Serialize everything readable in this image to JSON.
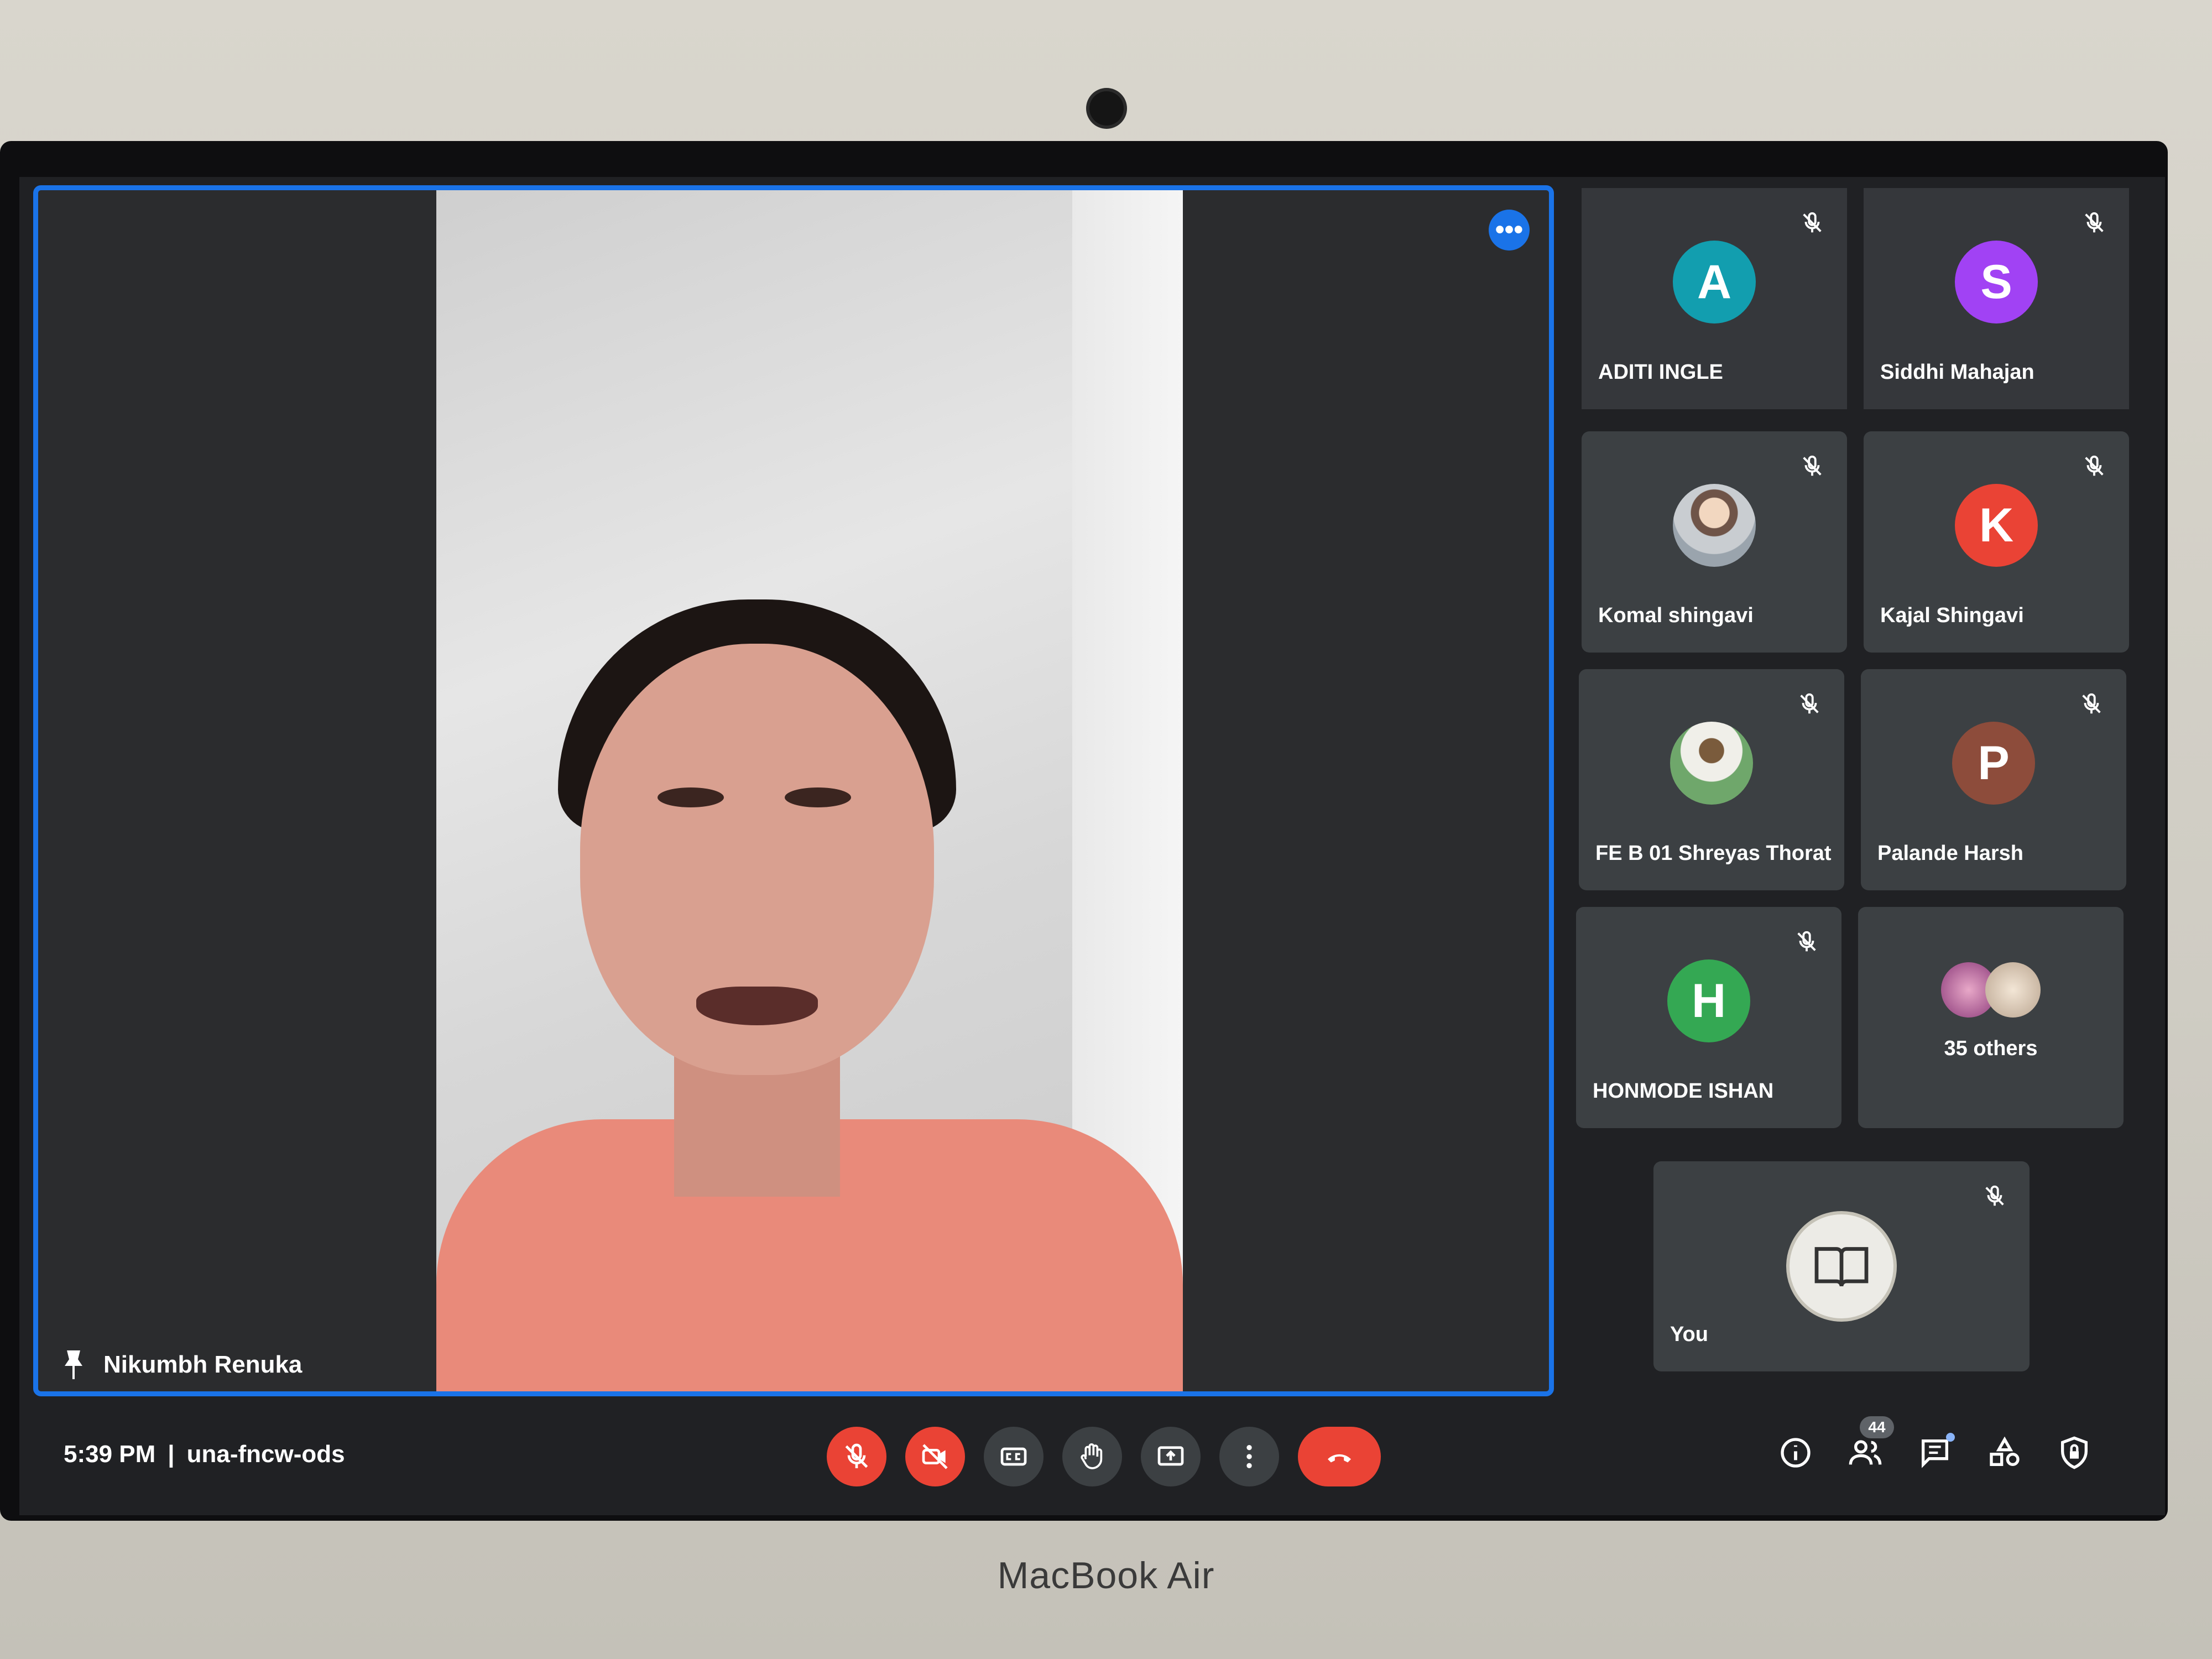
{
  "device": {
    "brand": "MacBook Air"
  },
  "stage": {
    "speaker_name": "Nikumbh Renuka",
    "more_label": "•••"
  },
  "participants": [
    {
      "name": "ADITI INGLE",
      "initial": "A",
      "color": "#129eaf"
    },
    {
      "name": "Siddhi Mahajan",
      "initial": "S",
      "color": "#a142f4"
    },
    {
      "name": "Komal shingavi",
      "initial": "",
      "color": ""
    },
    {
      "name": "Kajal Shingavi",
      "initial": "K",
      "color": "#ea4335"
    },
    {
      "name": "FE B 01 Shreyas Thorat",
      "initial": "",
      "color": ""
    },
    {
      "name": "Palande Harsh",
      "initial": "P",
      "color": "#8d4c3b"
    },
    {
      "name": "HONMODE ISHAN",
      "initial": "H",
      "color": "#34a853"
    }
  ],
  "others": {
    "label": "35 others"
  },
  "self": {
    "name": "You"
  },
  "meeting": {
    "time": "5:39 PM",
    "separator": "|",
    "code": "una-fncw-ods"
  },
  "people_count": "44",
  "icons": {
    "controls": [
      "mic-off-icon",
      "camera-off-icon",
      "captions-icon",
      "raise-hand-icon",
      "present-screen-icon",
      "more-options-icon",
      "end-call-icon"
    ],
    "right": [
      "info-icon",
      "people-icon",
      "chat-icon",
      "activities-icon",
      "host-controls-icon"
    ]
  }
}
